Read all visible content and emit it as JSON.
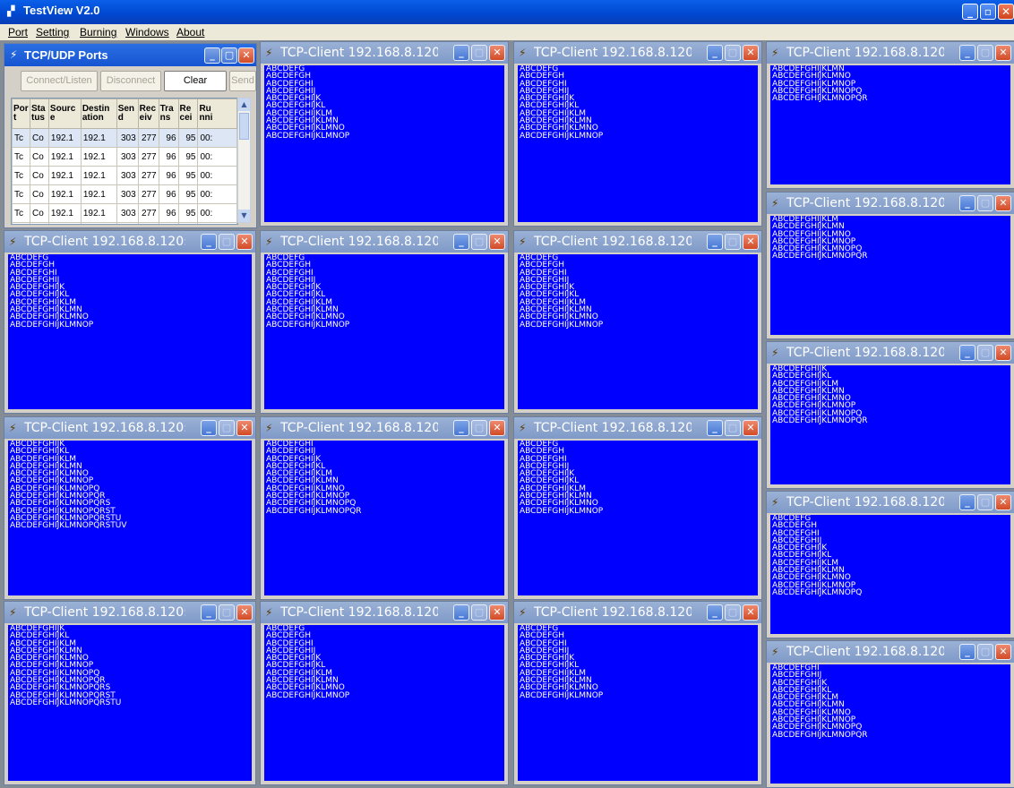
{
  "app": {
    "title": "TestView V2.0",
    "menu": [
      "Port",
      "Setting",
      "Burning",
      "Windows",
      "About"
    ]
  },
  "ports_panel": {
    "title": "TCP/UDP Ports",
    "buttons": [
      "Connect/Listen",
      "Disconnect",
      "Clear",
      "Send"
    ],
    "columns": [
      "Por t",
      "Sta tus",
      "Sourc e",
      "Destin ation",
      "Sen d",
      "Rec eiv",
      "Tra ns",
      "Re cei",
      "Ru nni"
    ],
    "rows": [
      [
        "Tc",
        "Co",
        "192.1",
        "192.1",
        "303",
        "277",
        "96",
        "95",
        "00:"
      ],
      [
        "Tc",
        "Co",
        "192.1",
        "192.1",
        "303",
        "277",
        "96",
        "95",
        "00:"
      ],
      [
        "Tc",
        "Co",
        "192.1",
        "192.1",
        "303",
        "277",
        "96",
        "95",
        "00:"
      ],
      [
        "Tc",
        "Co",
        "192.1",
        "192.1",
        "303",
        "277",
        "96",
        "95",
        "00:"
      ],
      [
        "Tc",
        "Co",
        "192.1",
        "192.1",
        "303",
        "277",
        "96",
        "95",
        "00:"
      ],
      [
        "Tc",
        "Co",
        "192.1",
        "192.1",
        "303",
        "277",
        "96",
        "95",
        "00:"
      ]
    ]
  },
  "client_title": "TCP-Client 192.168.8.120:40...",
  "client_windows": [
    {
      "start": 7,
      "end": 16
    },
    {
      "start": 7,
      "end": 16
    },
    {
      "start": 14,
      "end": 18
    },
    {
      "start": 13,
      "end": 18
    },
    {
      "start": 7,
      "end": 16
    },
    {
      "start": 7,
      "end": 16
    },
    {
      "start": 7,
      "end": 16
    },
    {
      "start": 11,
      "end": 18
    },
    {
      "start": 11,
      "end": 22
    },
    {
      "start": 9,
      "end": 18
    },
    {
      "start": 7,
      "end": 16
    },
    {
      "start": 7,
      "end": 17
    },
    {
      "start": 11,
      "end": 21
    },
    {
      "start": 7,
      "end": 16
    },
    {
      "start": 7,
      "end": 16
    },
    {
      "start": 9,
      "end": 18
    },
    {
      "start": 13,
      "end": 21
    }
  ]
}
